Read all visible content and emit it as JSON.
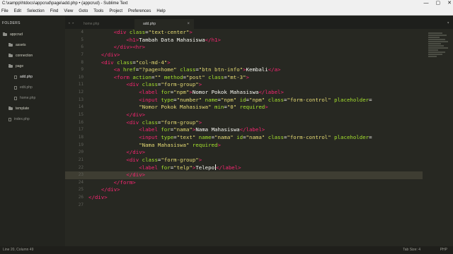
{
  "window": {
    "title": "C:\\xampp\\htdocs\\appcrud\\page\\add.php • (appcrud) - Sublime Text",
    "minimize": "—",
    "maximize": "▢",
    "close": "✕"
  },
  "menu": [
    "File",
    "Edit",
    "Selection",
    "Find",
    "View",
    "Goto",
    "Tools",
    "Project",
    "Preferences",
    "Help"
  ],
  "sidebar": {
    "header": "FOLDERS",
    "items": [
      {
        "label": "appcrud",
        "kind": "folder"
      },
      {
        "label": "assets",
        "kind": "folder"
      },
      {
        "label": "connection",
        "kind": "folder"
      },
      {
        "label": "page",
        "kind": "folder"
      },
      {
        "label": "add.php",
        "kind": "file"
      },
      {
        "label": "edit.php",
        "kind": "file"
      },
      {
        "label": "home.php",
        "kind": "file"
      },
      {
        "label": "template",
        "kind": "folder"
      },
      {
        "label": "index.php",
        "kind": "file"
      }
    ]
  },
  "tabs": [
    {
      "label": "home.php",
      "active": false
    },
    {
      "label": "add.php",
      "active": true
    }
  ],
  "tab_close": "×",
  "tab_nav": "◂ ▸",
  "tab_dropdown": "▾",
  "editor": {
    "line_numbers": [
      "4",
      "5",
      "6",
      "7",
      "8",
      "9",
      "10",
      "11",
      "12",
      "13",
      "14",
      "15",
      "16",
      "17",
      "18",
      "19",
      "20",
      "21",
      "22",
      "23",
      "24",
      "25",
      "26",
      "27"
    ],
    "current_line": "20"
  },
  "status": {
    "position": "Line 20, Column 49",
    "tab_size": "Tab Size: 4",
    "syntax": "PHP"
  },
  "colors": {
    "background": "#272822",
    "tag": "#f92672",
    "attribute": "#a6e22e",
    "string": "#e6db74",
    "text": "#f8f8f2",
    "sidebar": "#23241f"
  }
}
